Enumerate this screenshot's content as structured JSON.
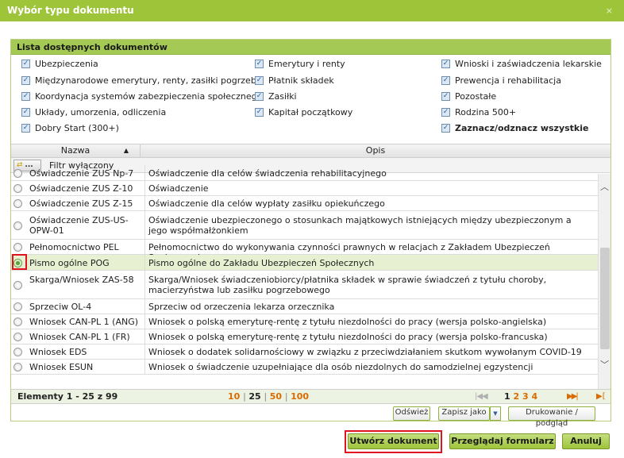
{
  "dialog": {
    "title": "Wybór typu dokumentu",
    "close": "×"
  },
  "panel": {
    "title": "Lista dostępnych dokumentów",
    "categories": [
      "Ubezpieczenia",
      "Emerytury i renty",
      "Wnioski i zaświadczenia lekarskie",
      "Międzynarodowe emerytury, renty, zasiłki pogrzeb.",
      "Płatnik składek",
      "Prewencja i rehabilitacja",
      "Koordynacja systemów zabezpieczenia społecznego",
      "Zasiłki",
      "Pozostałe",
      "Układy, umorzenia, odliczenia",
      "Kapitał początkowy",
      "Rodzina 500+",
      "Dobry Start (300+)",
      "Zaznacz/odznacz wszystkie"
    ]
  },
  "grid": {
    "col_name": "Nazwa",
    "col_desc": "Opis",
    "filter_button": "...",
    "filter_text": "Filtr wyłączony",
    "rows": [
      {
        "name": "Oświadczenie ZUS Np-7",
        "desc": "Oświadczenie dla celów świadczenia rehabilitacyjnego",
        "selected": false
      },
      {
        "name": "Oświadczenie ZUS Z-10",
        "desc": "Oświadczenie",
        "selected": false
      },
      {
        "name": "Oświadczenie ZUS Z-15",
        "desc": "Oświadczenie dla celów wypłaty zasiłku opiekuńczego",
        "selected": false
      },
      {
        "name": "Oświadczenie ZUS-US-OPW-01",
        "desc": "Oświadczenie ubezpieczonego o stosunkach majątkowych istniejących między ubezpieczonym a jego współmałżonkiem",
        "selected": false
      },
      {
        "name": "Pełnomocnictwo PEL",
        "desc": "Pełnomocnictwo do wykonywania czynności prawnych w relacjach z Zakładem Ubezpieczeń Społecznych",
        "selected": false
      },
      {
        "name": "Pismo ogólne POG",
        "desc": "Pismo ogólne do Zakładu Ubezpieczeń Społecznych",
        "selected": true
      },
      {
        "name": "Skarga/Wniosek ZAS-58",
        "desc": "Skarga/Wniosek świadczeniobiorcy/płatnika składek w sprawie świadczeń z tytułu choroby, macierzyństwa lub zasiłku pogrzebowego",
        "selected": false
      },
      {
        "name": "Sprzeciw OL-4",
        "desc": "Sprzeciw od orzeczenia lekarza orzecznika",
        "selected": false
      },
      {
        "name": "Wniosek CAN-PL 1 (ANG)",
        "desc": "Wniosek o polską emeryturę-rentę z tytułu niezdolności do pracy (wersja polsko-angielska)",
        "selected": false
      },
      {
        "name": "Wniosek CAN-PL 1 (FR)",
        "desc": "Wniosek o polską emeryturę-rentę z tytułu niezdolności do pracy (wersja polsko-francuska)",
        "selected": false
      },
      {
        "name": "Wniosek EDS",
        "desc": "Wniosek o dodatek solidarnościowy w związku z przeciwdziałaniem skutkom wywołanym COVID-19",
        "selected": false
      },
      {
        "name": "Wniosek ESUN",
        "desc": "Wniosek o świadczenie uzupełniające dla osób niezdolnych do samodzielnej egzystencji",
        "selected": false
      }
    ]
  },
  "pager": {
    "count": "Elementy 1 - 25 z 99",
    "sizes": [
      "10",
      "25",
      "50",
      "100"
    ],
    "current_size": "25",
    "pages": [
      "1",
      "2",
      "3",
      "4"
    ],
    "current_page": "1"
  },
  "buttons": {
    "refresh": "Odśwież",
    "save_as": "Zapisz jako",
    "print": "Drukowanie / podgląd",
    "create": "Utwórz dokument",
    "browse": "Przeglądaj formularz",
    "cancel": "Anuluj"
  }
}
